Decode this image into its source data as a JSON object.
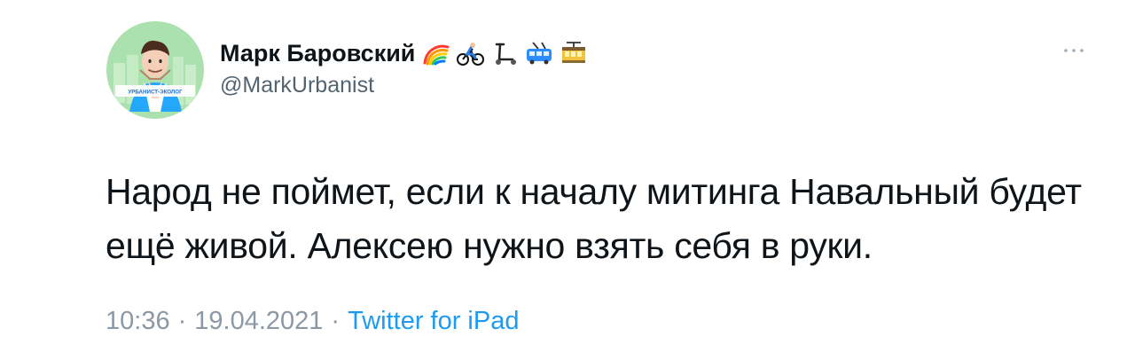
{
  "tweet": {
    "author": {
      "display_name": "Марк Баровский",
      "handle": "@MarkUrbanist",
      "avatar_badge_text": "УРБАНИСТ-ЭКОЛОГ",
      "name_emojis": [
        "rainbow",
        "person-biking",
        "kick-scooter",
        "trolleybus",
        "tram-car"
      ]
    },
    "text_lines": [
      "Народ не поймет, если к началу митинга Навальный будет",
      "ещё живой. Алексею нужно взять себя в руки."
    ],
    "meta": {
      "time": "10:36",
      "separator_1": "·",
      "date": "19.04.2021",
      "separator_2": "·",
      "source": "Twitter for iPad"
    },
    "icons": {
      "more": "more-horizontal-icon"
    }
  },
  "colors": {
    "primary_text": "#0f1419",
    "secondary_text": "#536471",
    "meta_text": "#8b98a5",
    "link": "#1d9bf0",
    "background": "#ffffff"
  }
}
